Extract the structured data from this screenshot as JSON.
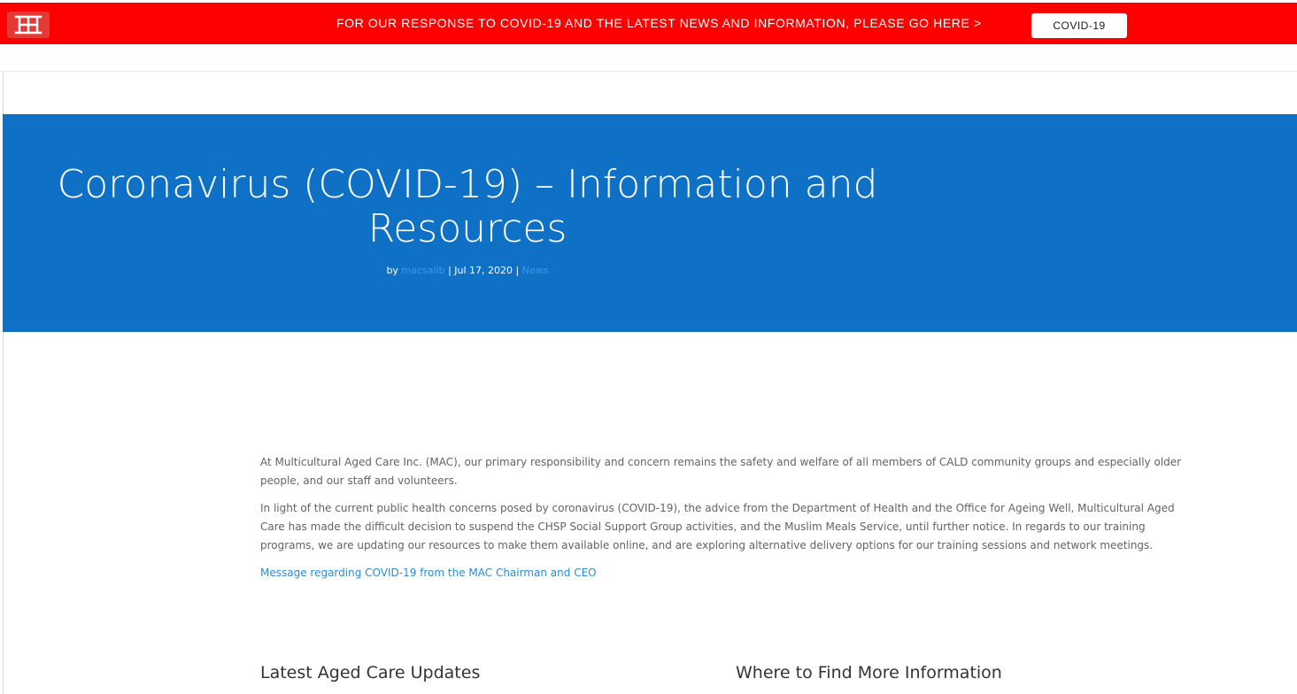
{
  "banner": {
    "logo_icon": "mac-logo-icon",
    "text": "FOR OUR RESPONSE TO COVID-19 AND THE LATEST NEWS AND INFORMATION, PLEASE GO HERE >",
    "button_label": "COVID-19",
    "color": "#ff0000"
  },
  "hero": {
    "title_line1": "Coronavirus (COVID-19) – Information and",
    "title_line2": "Resources",
    "meta": {
      "by": "by ",
      "author": "macsalib",
      "separator1": " | ",
      "date": "Jul 17, 2020",
      "separator2": " | ",
      "category": "News"
    },
    "color": "#0f71c5"
  },
  "content": {
    "paragraph1": "At Multicultural Aged Care Inc. (MAC), our primary responsibility and concern remains the safety and welfare of all members of CALD community groups and especially older people, and our staff and volunteers.",
    "paragraph2": "In light of the current public health concerns posed by coronavirus (COVID-19), the advice from the Department of Health and the Office for Ageing Well, Multicultural Aged Care has made the difficult decision to suspend the CHSP Social Support Group activities, and the Muslim Meals Service, until further notice. In regards to our training programs, we are updating our resources to make them available online, and are exploring alternative delivery options for our training sessions and network meetings.",
    "message_link": "Message regarding COVID-19 from the MAC Chairman and CEO",
    "link_color": "#2c8cd4"
  },
  "sections": {
    "left_heading": "Latest Aged Care Updates",
    "right_heading": "Where to Find More Information"
  }
}
